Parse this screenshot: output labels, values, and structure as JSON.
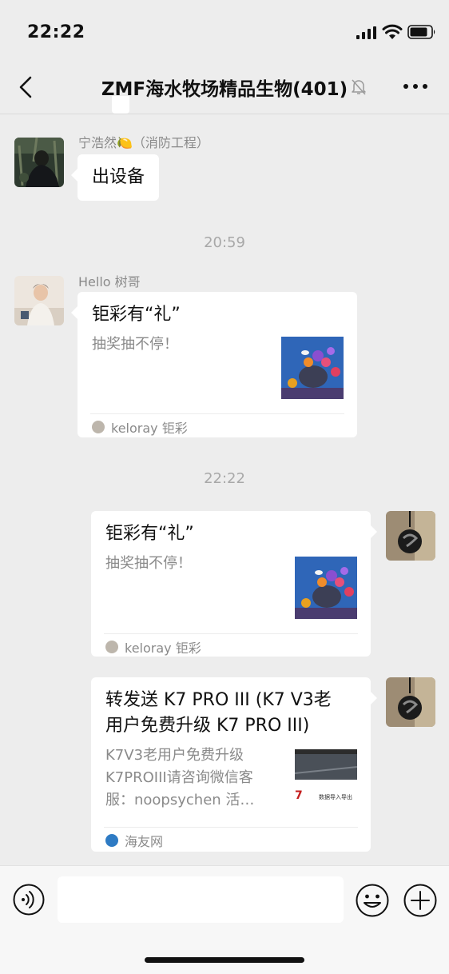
{
  "status_bar": {
    "time": "22:22"
  },
  "nav": {
    "title": "ZMF海水牧场精品生物(401)"
  },
  "messages": [
    {
      "sender": "宁浩然🍋（消防工程）",
      "text": "出设备"
    },
    {
      "timestamp": "20:59"
    },
    {
      "sender": "Hello  树哥",
      "card_title": "钜彩有“礼”",
      "card_desc": "抽奖抽不停！",
      "source": "keloray 钜彩"
    },
    {
      "timestamp": "22:22"
    },
    {
      "card_title": "钜彩有“礼”",
      "card_desc": "抽奖抽不停！",
      "source": "keloray 钜彩"
    },
    {
      "card_title_line1": "转发送 K7 PRO III (K7 V3老",
      "card_title_line2": "用户免费升级 K7 PRO III)",
      "card_desc_line1": "K7V3老用户免费升级",
      "card_desc_line2": "K7PROIII请咨询微信客",
      "card_desc_line3": "服：noopsychen 活…",
      "thumb_text_1": "7",
      "thumb_text_2": "数据导入导出",
      "source": "海友网"
    }
  ],
  "input_bar": {
    "placeholder": ""
  },
  "icons": [
    "signal-icon",
    "wifi-icon",
    "battery-icon",
    "back-icon",
    "mute-icon",
    "more-icon",
    "voice-icon",
    "emoji-icon",
    "plus-icon"
  ],
  "colors": {
    "background": "#EDEDED",
    "bubble": "#FFFFFF",
    "meta_text": "#8A8A8A",
    "timestamp": "#A8A8A8"
  }
}
